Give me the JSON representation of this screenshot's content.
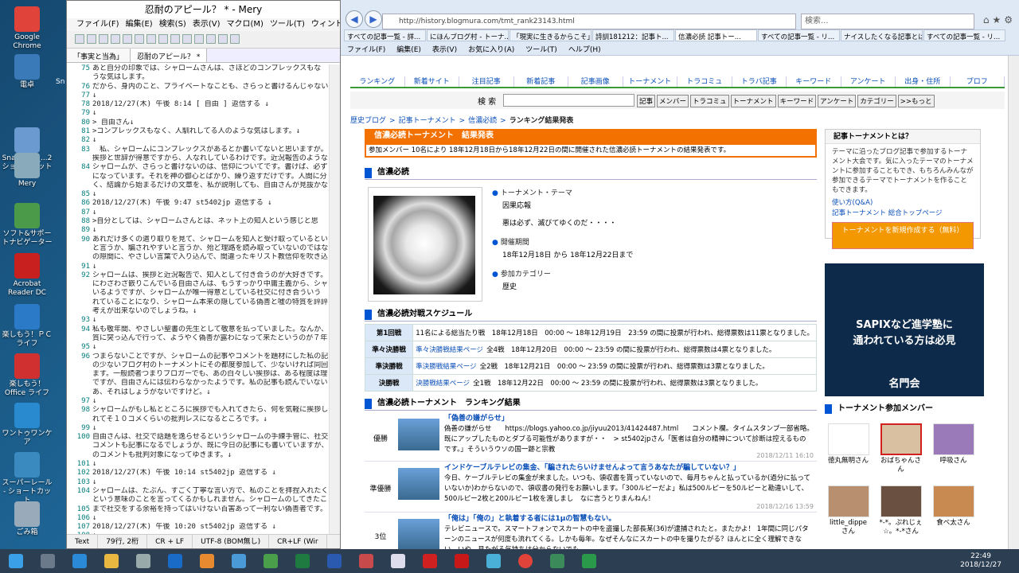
{
  "desktop": {
    "icons": [
      {
        "label": "Google Chrome",
        "color": "#e0433a"
      },
      {
        "label": "電卓",
        "color": "#3a7ab8"
      },
      {
        "label": "SnapCrab_...2 ショートカット",
        "color": "#6a9ad0"
      },
      {
        "label": "Mery",
        "color": "#8ab"
      },
      {
        "label": "ソフト&サポートナビゲーター",
        "color": "#4a9a4a"
      },
      {
        "label": "Acrobat Reader DC",
        "color": "#c8201e"
      },
      {
        "label": "楽しもう！ＰＣライフ",
        "color": "#2a7ac8"
      },
      {
        "label": "楽しもう！Office ライフ",
        "color": "#d03030"
      },
      {
        "label": "ワントゥワンケア",
        "color": "#2a8ad0"
      },
      {
        "label": "スーパーレール - ショートカット",
        "color": "#3a8ac0"
      },
      {
        "label": "ごみ箱",
        "color": "#9ab"
      }
    ]
  },
  "mery": {
    "title": "忍耐のアピール？ * - Mery",
    "menu": [
      "ファイル(F)",
      "編集(E)",
      "検索(S)",
      "表示(V)",
      "マクロ(M)",
      "ツール(T)",
      "ウィンドウ(W)",
      "ヘルプ(H)"
    ],
    "tabs": [
      "「事実と当為」",
      "忍耐のアピール？ *"
    ],
    "lines": [
      {
        "n": "75",
        "t": "あと自分の印象では、シャロームさんは、さほどのコンプレックスもな"
      },
      {
        "n": "",
        "t": "うな気はします。"
      },
      {
        "n": "76",
        "t": "だから、身内のこと、プライベートなことも、さらっと書けるんじゃない"
      },
      {
        "n": "77",
        "t": "↓"
      },
      {
        "n": "78",
        "t": "2018/12/27(木) 午後 8:14 [ 自由 ] 返信する ↓"
      },
      {
        "n": "79",
        "t": "↓"
      },
      {
        "n": "80",
        "t": "> 自由さん↓"
      },
      {
        "n": "81",
        "t": ">コンプレックスもなく、人馴れしてる人のような気はします。↓"
      },
      {
        "n": "82",
        "t": "↓"
      },
      {
        "n": "83",
        "t": "　私、シャロームにコンプレックスがあるとか書いてないと思いますが。シ"
      },
      {
        "n": "",
        "t": "挨拶と世辞が得意ですから、人なれしているわけです。近況報告のような"
      },
      {
        "n": "84",
        "t": "シャロームが、さらっと書けないのは、信仰についてです。書けば、必ず"
      },
      {
        "n": "",
        "t": "になっています。それを神の御心とばかり、繰り返すだけです。人間に分"
      },
      {
        "n": "",
        "t": "く、結論から始まるだけの文章を、私が説明しても、自由さんが見抜かな"
      },
      {
        "n": "85",
        "t": "↓"
      },
      {
        "n": "86",
        "t": "2018/12/27(木) 午後 9:47 st5402jp 返信する ↓"
      },
      {
        "n": "87",
        "t": "↓"
      },
      {
        "n": "88",
        "t": ">自分としては、シャロームさんとは、ネット上の知人という感じと思"
      },
      {
        "n": "89",
        "t": "↓"
      },
      {
        "n": "90",
        "t": "あれだけ多くの遣り取りを見て、シャロームを知人と受け取っているとい"
      },
      {
        "n": "",
        "t": "と言うか、騙されやすいと言うか、殆ど理路を読み取っていないのではな"
      },
      {
        "n": "",
        "t": "の隙間に、やさしい言葉で入り込んで、間違ったキリスト教信仰を吹き込"
      },
      {
        "n": "91",
        "t": "↓"
      },
      {
        "n": "92",
        "t": "シャロームは、挨拶と近況報告で、知人として付き合うのが大好きです。"
      },
      {
        "n": "",
        "t": "にわざわざ嵌りこんでいる自由さんは、もうすっかり中庸主義から、シャ"
      },
      {
        "n": "",
        "t": "いるようですが、シャロームが唯一得意としている社交に付き合ういう"
      },
      {
        "n": "",
        "t": "れていることになり、シャローム本来の隠している偽善と嘘の特質を評評"
      },
      {
        "n": "",
        "t": "考えが出来ないのでしょうね。↓"
      },
      {
        "n": "93",
        "t": "↓"
      },
      {
        "n": "94",
        "t": "私も敬年間、やさしい聖書の先生として敬意を払っていました。なんか、"
      },
      {
        "n": "",
        "t": "質に突っ込んで行って、ようやく偽善が露わになって来たというのが７年"
      },
      {
        "n": "95",
        "t": "↓"
      },
      {
        "n": "96",
        "t": "つまらないことですが、シャロームの記事やコメントを題材にした私の記"
      },
      {
        "n": "",
        "t": "の少ないブログ村のトーナメントにその都度参加して、少ないければ同回"
      },
      {
        "n": "",
        "t": "ます。一般読者つまりブロガーでも、あの白々しい挨拶は、ある程度は理"
      },
      {
        "n": "",
        "t": "ですが、自由さんには伝わらなかったようです。私の記事も読んでいない"
      },
      {
        "n": "",
        "t": "あ、それはしょうがないですけど。↓"
      },
      {
        "n": "97",
        "t": "↓"
      },
      {
        "n": "98",
        "t": "シャロームがもし私とところに挨拶でも入れてきたら、何を気軽に挨拶し"
      },
      {
        "n": "",
        "t": "れてそ１０コメくらいの批判レスになるところです。↓"
      },
      {
        "n": "99",
        "t": "↓"
      },
      {
        "n": "100",
        "t": "自由さんは、社交で話題を逸らせるというシャロームの手練手管に、社交"
      },
      {
        "n": "",
        "t": "コメントも記事になるでしょうが、既に今日の記事にも書いていますが、"
      },
      {
        "n": "",
        "t": "のコメントも批判対象になってゆきます。↓"
      },
      {
        "n": "101",
        "t": "↓"
      },
      {
        "n": "102",
        "t": "2018/12/27(木) 午後 10:14 st5402jp 返信する ↓"
      },
      {
        "n": "103",
        "t": "↓"
      },
      {
        "n": "104",
        "t": "シャロームは、たぶん、すごく丁寧な言い方で、私のことを拝捏入れたく"
      },
      {
        "n": "",
        "t": "という意味のことを言ってくるかもしれません。シャロームのしてきたこ"
      },
      {
        "n": "105",
        "t": "まで社交をする余裕を持ってはいけない百害あって一利ない偽善者です。"
      },
      {
        "n": "106",
        "t": "↓"
      },
      {
        "n": "107",
        "t": "2018/12/27(木) 午後 10:20 st5402jp 返信する ↓"
      },
      {
        "n": "108",
        "t": "↓"
      },
      {
        "n": "109",
        "t": "↓"
      }
    ],
    "status": [
      "Text",
      "79行, 2桁",
      "CR + LF",
      "UTF-8 (BOM無し)",
      "CR+LF (Wir"
    ]
  },
  "ie": {
    "url": "http://history.blogmura.com/tmt_rank23143.html",
    "search_placeholder": "検索...",
    "tabs": [
      "すべての記事一覧 - 詳...",
      "にほんブログ村 - トーナ...",
      "「現実に生きるからこそ」...",
      "詩訓181212：記事ト...",
      "信濃必読 記事トー...",
      "すべての記事一覧 - リ...",
      "ナイスしたくなる記事とは...",
      "すべての記事一覧 - リ..."
    ],
    "menu": [
      "ファイル(F)",
      "編集(E)",
      "表示(V)",
      "お気に入り(A)",
      "ツール(T)",
      "ヘルプ(H)"
    ]
  },
  "page": {
    "gnav": [
      "ランキング",
      "新着サイト",
      "注目記事",
      "新着記事",
      "記事画像",
      "トーナメント",
      "トラコミュ",
      "トラバ記事",
      "キーワード",
      "アンケート",
      "出身・住所",
      "プロフ"
    ],
    "search_label": "検 索",
    "search_buttons": [
      "記事",
      "メンバー",
      "トラコミュ",
      "トーナメント",
      "キーワード",
      "アンケート",
      "カテゴリー",
      ">>もっと"
    ],
    "breadcrumb": [
      "歴史ブログ",
      ">",
      "記事トーナメント",
      ">",
      "信濃必読",
      ">",
      "ランキング結果発表"
    ],
    "header": "信濃必読トーナメント　結果発表",
    "description": "参加メンバー 10名により 18年12月18日から18年12月22日の間に開催された信濃必読トーナメントの結果発表です。",
    "section_title": "信濃必読",
    "theme_label": "トーナメント・テーマ",
    "theme_value": "因果応報",
    "theme_sub": "悪は必ず、滅びてゆくのだ・・・・",
    "period_label": "開催期間",
    "period_value": "18年12月18日 から 18年12月22日まで",
    "category_label": "参加カテゴリー",
    "category_value": "歴史",
    "schedule_title": "信濃必読対戦スケジュール",
    "schedule": [
      {
        "h": "第1回戦",
        "t": "11名による総当たり戦　18年12月18日　00:00 ～ 18年12月19日　23:59 の間に投票が行われ、総得票数は11票となりました。",
        "link": ""
      },
      {
        "h": "準々決勝戦",
        "link": "準々決勝戦結果ページ",
        "t": "全4戦　18年12月20日　00:00 ～ 23:59 の間に投票が行われ、総得票数は4票となりました。"
      },
      {
        "h": "準決勝戦",
        "link": "準決勝戦結果ページ",
        "t": "全2戦　18年12月21日　00:00 ～ 23:59 の間に投票が行われ、総得票数は3票となりました。"
      },
      {
        "h": "決勝戦",
        "link": "決勝戦結果ページ",
        "t": "全1戦　18年12月22日　00:00 ～ 23:59 の間に投票が行われ、総得票数は3票となりました。"
      }
    ],
    "ranking_title": "信濃必読トーナメント　ランキング結果",
    "ranking": [
      {
        "place": "優勝",
        "title": "「偽善の嫌がらせ」",
        "body": "偽善の嫌がらせ　　https://blogs.yahoo.co.jp/jiyuu2013/41424487.html　　コメント欄。タイムスタンプ一部省略。　既にアップしたものとダブる可能性がありますが・・　> st5402jpさん「医者は自分の精神について診断は控えるものです。」そういうウソの国一跡と宗教",
        "date": "2018/12/11 16:10"
      },
      {
        "place": "準優勝",
        "title": "インドケーブルテレビの集金、「騙されたらいけませんよって言うあなたが騙していない？」",
        "body": "今日、ケーブルテレビの集金が来ました。いつも、領収書を貰っていないので、毎月ちゃんと払っているか(過分に払っていないか)わからないので、領収書の発行をお願いします。「300ルピーだよ」私は500ルピーを50ルピーと勘違いして、500ルピー2枚と200ルピー1枚を渡しまし　なに言うとりまんねん！",
        "date": "2018/12/16 13:59"
      },
      {
        "place": "3位",
        "title": "「俺は」「俺の」と執着する者には1μの智慧もない。",
        "body": "テレビニュースで。スマートフォンでスカートの中を盗撮した部長某(36)が逮捕されたと。またかよ！ 1年間に同じパターンのニュースが何度も流れてくる。しかも毎年。なぜそんなにスカートの中を撮りたがる？ほんとに全く理解できない。いや、見たがる気持ちは分からないでも",
        "date": ""
      }
    ],
    "side_title": "記事トーナメントとは？",
    "side_text": "テーマに沿ったブログ記事で参加するトーナメント大会です。気に入ったテーマのトーナメントに参加することもでき、もちろんみんなが参加できるテーマでトーナメントを作ることもできます。",
    "side_links": [
      "使い方(Q&A)",
      "記事トーナメント 総合トップページ"
    ],
    "side_button": "トーナメントを新規作成する（無料）",
    "ad_line1": "SAPIXなど進学塾に",
    "ad_line2": "通われている方は必見",
    "ad_logo": "名門会",
    "members_title": "トーナメント参加メンバー",
    "members": [
      "徳丸無明さん",
      "おばちゃんさん",
      "呼吸さん",
      "little_dippeさん",
      "*-*。ぷれじぇ☆。*-*さん",
      "食べ太さん"
    ]
  },
  "taskbar": {
    "time": "22:49",
    "date": "2018/12/27"
  }
}
